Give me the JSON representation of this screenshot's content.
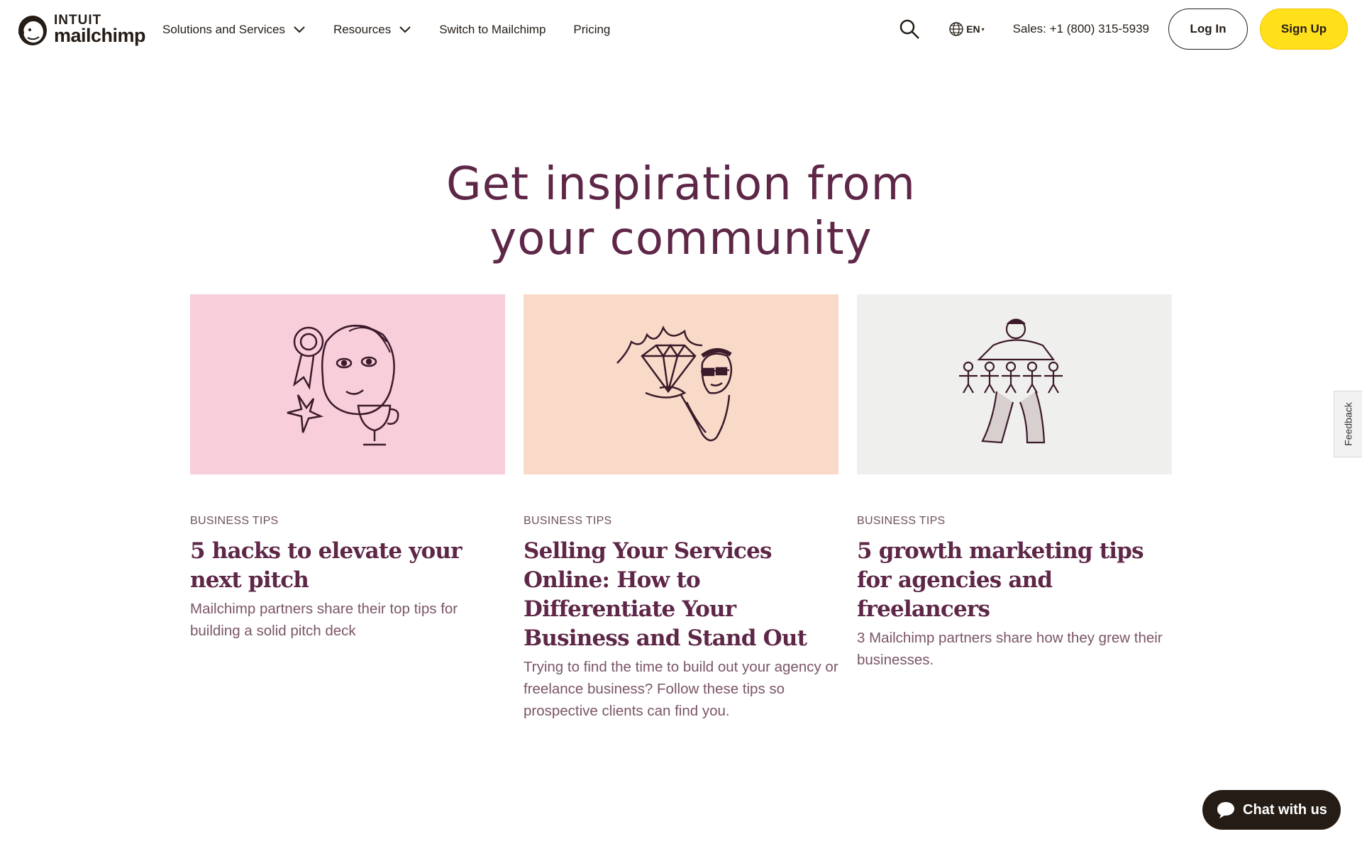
{
  "brand": {
    "intuit": "INTUIT",
    "name": "mailchimp"
  },
  "nav": {
    "solutions": "Solutions and Services",
    "resources": "Resources",
    "switch": "Switch to Mailchimp",
    "pricing": "Pricing"
  },
  "header": {
    "language": "EN",
    "sales": "Sales: +1 (800) 315-5939",
    "login": "Log In",
    "signup": "Sign Up"
  },
  "section": {
    "title_line1": "Get inspiration from",
    "title_line2": "your community"
  },
  "cards": [
    {
      "category": "BUSINESS TIPS",
      "title": "5 hacks to elevate your next pitch",
      "description": "Mailchimp partners share their top tips for building a solid pitch deck",
      "bg_color": "#f7ced9",
      "icon": "woman-with-trophy-illustration"
    },
    {
      "category": "BUSINESS TIPS",
      "title": "Selling Your Services Online: How to Differentiate Your Business and Stand Out",
      "description": "Trying to find the time to build out your agency or freelance business? Follow these tips so prospective clients can find you.",
      "bg_color": "#f9dac8",
      "icon": "man-holding-diamond-illustration"
    },
    {
      "category": "BUSINESS TIPS",
      "title": "5 growth marketing tips for agencies and freelancers",
      "description": "3 Mailchimp partners share how they grew their businesses.",
      "bg_color": "#efefed",
      "icon": "person-with-paper-dolls-illustration"
    }
  ],
  "feedback": "Feedback",
  "chat": "Chat with us",
  "colors": {
    "accent_plum": "#5e2747",
    "cta_yellow": "#ffe01b",
    "ink": "#241c15"
  }
}
